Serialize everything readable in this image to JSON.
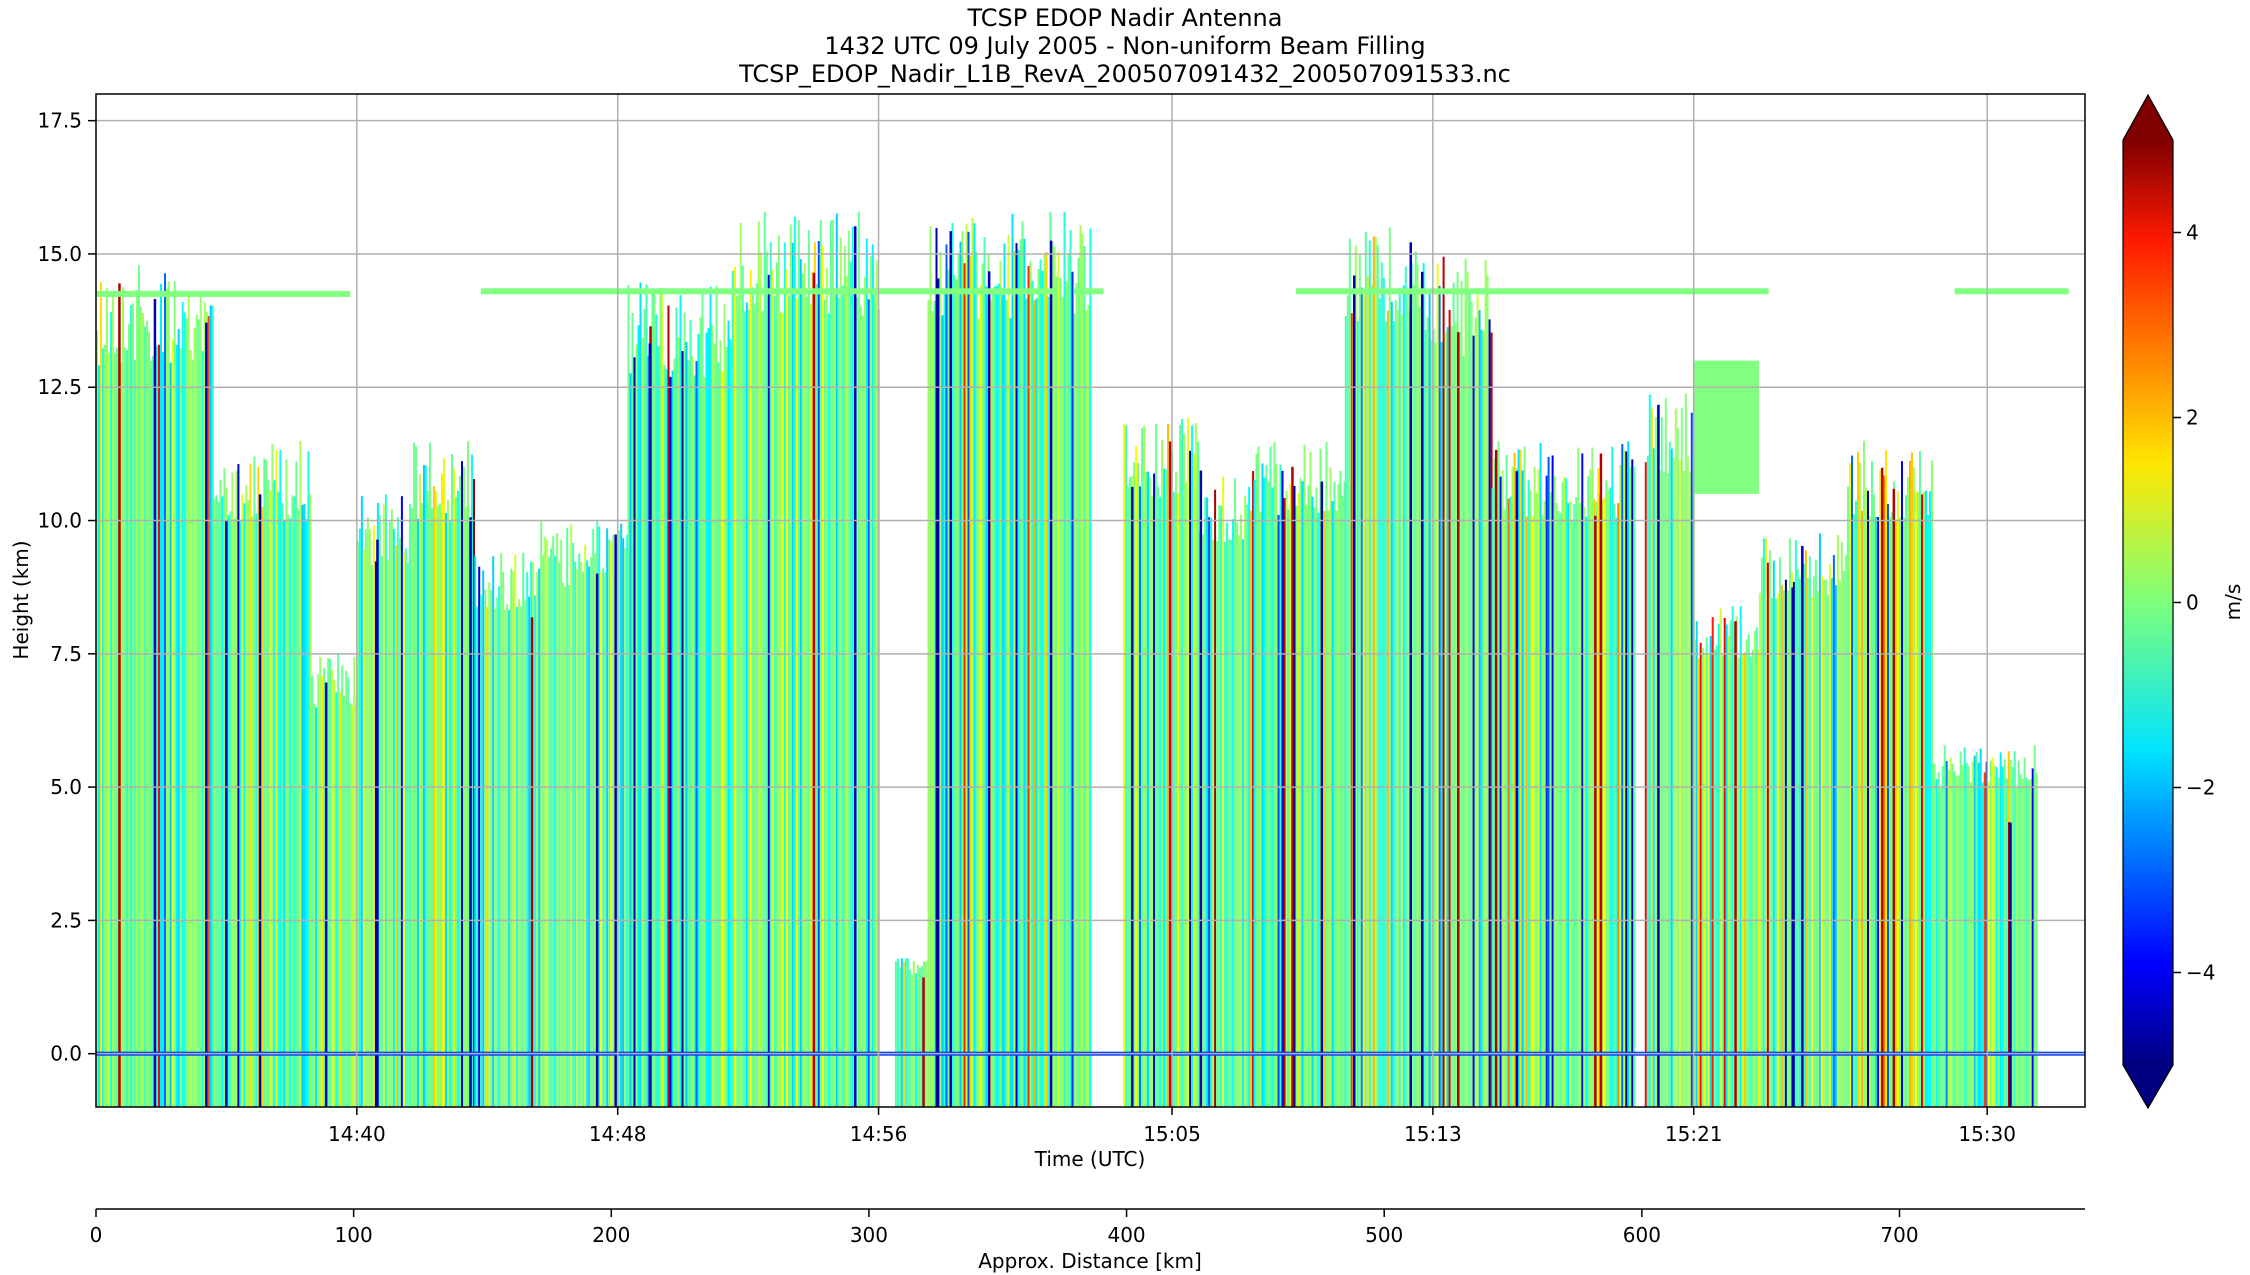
{
  "chart_data": {
    "type": "heatmap",
    "title": [
      "TCSP EDOP Nadir Antenna",
      "1432 UTC 09 July 2005 - Non-uniform Beam Filling",
      "TCSP_EDOP_Nadir_L1B_RevA_200507091432_200507091533.nc"
    ],
    "xlabel": "Time (UTC)",
    "ylabel": "Height (km)",
    "x2label": "Approx. Distance [km]",
    "colorbar_label": "m/s",
    "colorbar_range": [
      -5,
      5
    ],
    "colorbar_ticks": [
      -4,
      -2,
      0,
      2,
      4
    ],
    "colorbar_tick_labels": [
      "−4",
      "−2",
      "0",
      "2",
      "4"
    ],
    "colormap": "jet",
    "ylim": [
      -1.0,
      18.0
    ],
    "y_ticks": [
      0.0,
      2.5,
      5.0,
      7.5,
      10.0,
      12.5,
      15.0,
      17.5
    ],
    "y_tick_labels": [
      "0.0",
      "2.5",
      "5.0",
      "7.5",
      "10.0",
      "12.5",
      "15.0",
      "17.5"
    ],
    "time_range_min": [
      0,
      61
    ],
    "time_ticks_min": [
      8.0,
      16.0,
      24.0,
      33.0,
      41.0,
      49.0,
      58.0
    ],
    "time_tick_labels": [
      "14:40",
      "14:48",
      "14:56",
      "15:05",
      "15:13",
      "15:21",
      "15:30"
    ],
    "distance_range_km": [
      0,
      772
    ],
    "distance_ticks": [
      0,
      100,
      200,
      300,
      400,
      500,
      600,
      700
    ],
    "distance_tick_labels": [
      "0",
      "100",
      "200",
      "300",
      "400",
      "500",
      "600",
      "700"
    ],
    "grid": true,
    "echo_columns": [
      {
        "t": [
          0.0,
          2.2
        ],
        "top_km": 14.8
      },
      {
        "t": [
          2.2,
          3.6
        ],
        "top_km": 14.5
      },
      {
        "t": [
          3.6,
          6.6
        ],
        "top_km": 11.5
      },
      {
        "t": [
          6.6,
          8.0
        ],
        "top_km": 7.5
      },
      {
        "t": [
          8.0,
          9.6
        ],
        "top_km": 10.5
      },
      {
        "t": [
          9.6,
          11.6
        ],
        "top_km": 11.5
      },
      {
        "t": [
          11.6,
          13.5
        ],
        "top_km": 9.5
      },
      {
        "t": [
          13.5,
          16.3
        ],
        "top_km": 10.0
      },
      {
        "t": [
          16.3,
          19.5
        ],
        "top_km": 14.5
      },
      {
        "t": [
          19.5,
          24.0
        ],
        "top_km": 15.8
      },
      {
        "t": [
          24.5,
          25.5
        ],
        "top_km": 1.8
      },
      {
        "t": [
          25.5,
          30.5
        ],
        "top_km": 15.8
      },
      {
        "t": [
          31.5,
          33.8
        ],
        "top_km": 12.0
      },
      {
        "t": [
          33.8,
          35.5
        ],
        "top_km": 11.0
      },
      {
        "t": [
          35.5,
          38.3
        ],
        "top_km": 11.5
      },
      {
        "t": [
          38.3,
          40.5
        ],
        "top_km": 15.5
      },
      {
        "t": [
          40.5,
          42.8
        ],
        "top_km": 15.0
      },
      {
        "t": [
          42.8,
          45.0
        ],
        "top_km": 11.5
      },
      {
        "t": [
          45.0,
          47.2
        ],
        "top_km": 11.5
      },
      {
        "t": [
          47.5,
          49.0
        ],
        "top_km": 12.5
      },
      {
        "t": [
          49.0,
          51.0
        ],
        "top_km": 8.5
      },
      {
        "t": [
          51.0,
          53.7
        ],
        "top_km": 9.8
      },
      {
        "t": [
          53.7,
          56.3
        ],
        "top_km": 11.5
      },
      {
        "t": [
          56.3,
          59.5
        ],
        "top_km": 5.8
      }
    ],
    "anvil_layer": [
      {
        "t": [
          0.0,
          7.8
        ],
        "height_km": 14.25
      },
      {
        "t": [
          11.8,
          29.5
        ],
        "height_km": 14.3
      },
      {
        "t": [
          30.0,
          30.9
        ],
        "height_km": 14.3
      },
      {
        "t": [
          36.8,
          51.3
        ],
        "height_km": 14.3
      },
      {
        "t": [
          57.0,
          60.5
        ],
        "height_km": 14.3
      }
    ],
    "cirrus_patches": [
      {
        "t": [
          49.0,
          51.0
        ],
        "height_km": [
          10.5,
          13.0
        ]
      }
    ]
  }
}
